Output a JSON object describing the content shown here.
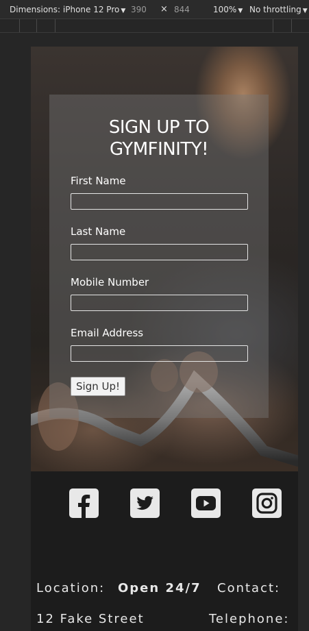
{
  "devtools": {
    "dimensions_label": "Dimensions: iPhone 12 Pro",
    "width": "390",
    "times": "×",
    "height": "844",
    "zoom": "100%",
    "throttling": "No throttling",
    "caret": "▼"
  },
  "form": {
    "title_line1": "SIGN UP TO",
    "title_line2": "GYMFINITY!",
    "fields": [
      {
        "label": "First Name",
        "value": ""
      },
      {
        "label": "Last Name",
        "value": ""
      },
      {
        "label": "Mobile Number",
        "value": ""
      },
      {
        "label": "Email Address",
        "value": ""
      }
    ],
    "submit_label": "Sign Up!"
  },
  "social": {
    "icons": [
      "facebook-icon",
      "twitter-icon",
      "youtube-icon",
      "instagram-icon"
    ],
    "icon_color": "#e8e8e8"
  },
  "footer": {
    "location_label": "Location:",
    "hours": "Open 24/7",
    "contact_label": "Contact:",
    "address": "12 Fake Street",
    "telephone_label": "Telephone:"
  },
  "colors": {
    "footer_bg": "#1c1c1c",
    "form_overlay": "rgba(120,120,120,0.42)"
  }
}
